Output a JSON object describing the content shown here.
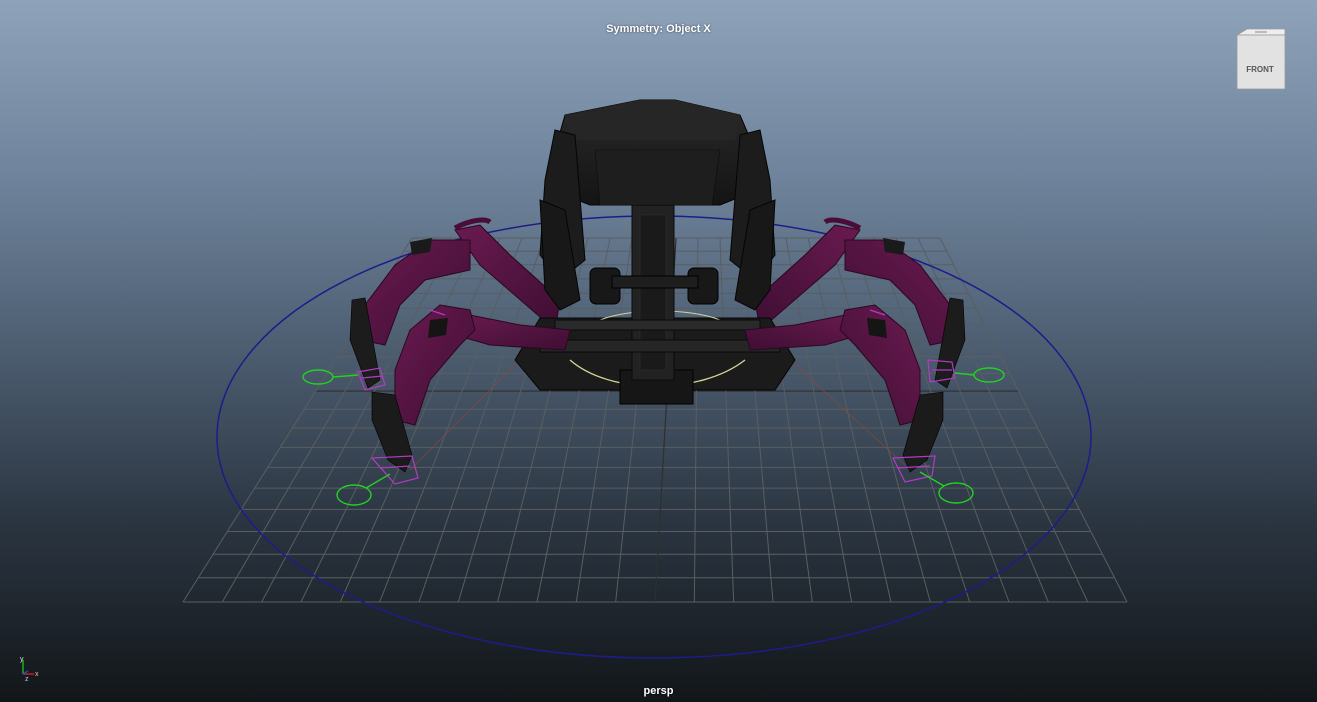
{
  "viewport": {
    "symmetry_label": "Symmetry: Object X",
    "camera_label": "persp"
  },
  "view_cube": {
    "face_label": "FRONT"
  },
  "axis_gizmo": {
    "x_label": "x",
    "y_label": "y",
    "z_label": "z"
  },
  "colors": {
    "grid": "#5a5e61",
    "grid_center": "#2f2f2f",
    "circle_control": "#1d1c8a",
    "foot_control": "#22d222",
    "ik_handle": "#b43ac4",
    "leg_mesh": "#5e1547",
    "body_mesh": "#1d1d1d",
    "axis_x": "#e02020",
    "axis_y": "#20c020",
    "axis_z": "#2050e0"
  },
  "icons": [
    "view-cube-icon",
    "axis-gizmo-icon"
  ]
}
